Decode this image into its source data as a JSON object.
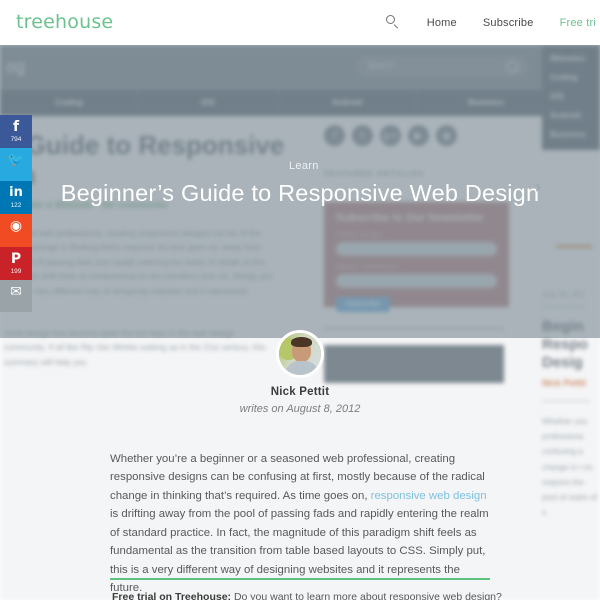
{
  "header": {
    "logo": "treehouse",
    "search_icon": "search-icon",
    "nav": [
      {
        "label": "Home",
        "accent": false
      },
      {
        "label": "Subscribe",
        "accent": false
      },
      {
        "label": "Free tri",
        "accent": true
      }
    ]
  },
  "background_page": {
    "blog_title": "og",
    "search_placeholder": "Search",
    "nav_tabs": [
      "Coding",
      "iOS",
      "Android",
      "Business"
    ],
    "dropdown_items": [
      "Websites",
      "Coding",
      "iOS",
      "Android",
      "Business"
    ],
    "article": {
      "title": "s Guide to Responsive gn",
      "meta_date": "2",
      "meta_category": "Make a Website",
      "meta_comments": "No comments",
      "paragraph_1": "easoned web professional, creating responsive designs can be of the radical change in thinking that's required. As time goes on, away from the pool of passing fads and rapidly entering the realm of nitude of this paradigm shift feels as fundamental as the transition from so. Simply put, this is a very different way of designing websites and it represents",
      "paragraph_2": "nsive design has become quite the hot topic in the web design community. If all like Rip Van Winkle waking up in the 21st century, this summary will help you"
    },
    "sidebar": {
      "social_icons": [
        "facebook-icon",
        "twitter-icon",
        "googleplus-icon",
        "youtube-icon",
        "rss-icon"
      ],
      "social_glyphs": [
        "f",
        "t",
        "g+",
        "▶",
        "◉"
      ],
      "featured_heading": "FEATURED ARTICLES",
      "newsletter": {
        "title": "Subscribe to Our Newsletter",
        "first_name_label": "FIRST NAME",
        "email_label": "EMAIL ADDRESS",
        "button_label": "Subscribe"
      }
    },
    "right_column": {
      "date": "July 26, 201",
      "title": "Begin Respo Desig",
      "author": "Nick Pettit",
      "body": "Whether you professiona confusing a change in t on, respons the pool of realm of s"
    }
  },
  "hero": {
    "kicker": "Learn",
    "title": "Beginner’s Guide to Responsive Web Design",
    "next_arrow": "chevron-right-icon"
  },
  "share_rail": [
    {
      "network": "facebook",
      "glyph": "f",
      "count": "794",
      "color": "#3b5998"
    },
    {
      "network": "twitter",
      "glyph": "ᴠ",
      "count": "",
      "color": "#28a9e0"
    },
    {
      "network": "linkedin",
      "glyph": "in",
      "count": "122",
      "color": "#0077b5"
    },
    {
      "network": "reddit",
      "glyph": "◉",
      "count": "",
      "color": "#f04b23"
    },
    {
      "network": "pinterest",
      "glyph": "P",
      "count": "199",
      "color": "#c92228"
    },
    {
      "network": "email",
      "glyph": "✉",
      "count": "",
      "color": "#9aa3a8"
    }
  ],
  "byline": {
    "avatar": "author-avatar",
    "author_name": "Nick Pettit",
    "date_line": "writes on August 8, 2012"
  },
  "article": {
    "paragraph_part_1": "Whether you’re a beginner or a seasoned web professional, creating responsive designs can be confusing at first, mostly because of the radical change in thinking that’s required. As time goes on, ",
    "link_text": "responsive web design",
    "paragraph_part_2": " is drifting away from the pool of passing fads and rapidly entering the realm of standard practice. In fact, the magnitude of this paradigm shift feels as fundamental as the transition from table based layouts to CSS. Simply put, this is a very different way of designing websites and it represents the future."
  },
  "promo": {
    "lead": "Free trial on Treehouse: ",
    "text": "Do you want to learn more about responsive web design?",
    "link": ""
  },
  "colors": {
    "brand_green": "#6cc28e",
    "rule_green": "#5fc17f",
    "link_blue": "#7fc0e0",
    "hero_overlay": "#74838d",
    "body_text": "#58595b"
  }
}
